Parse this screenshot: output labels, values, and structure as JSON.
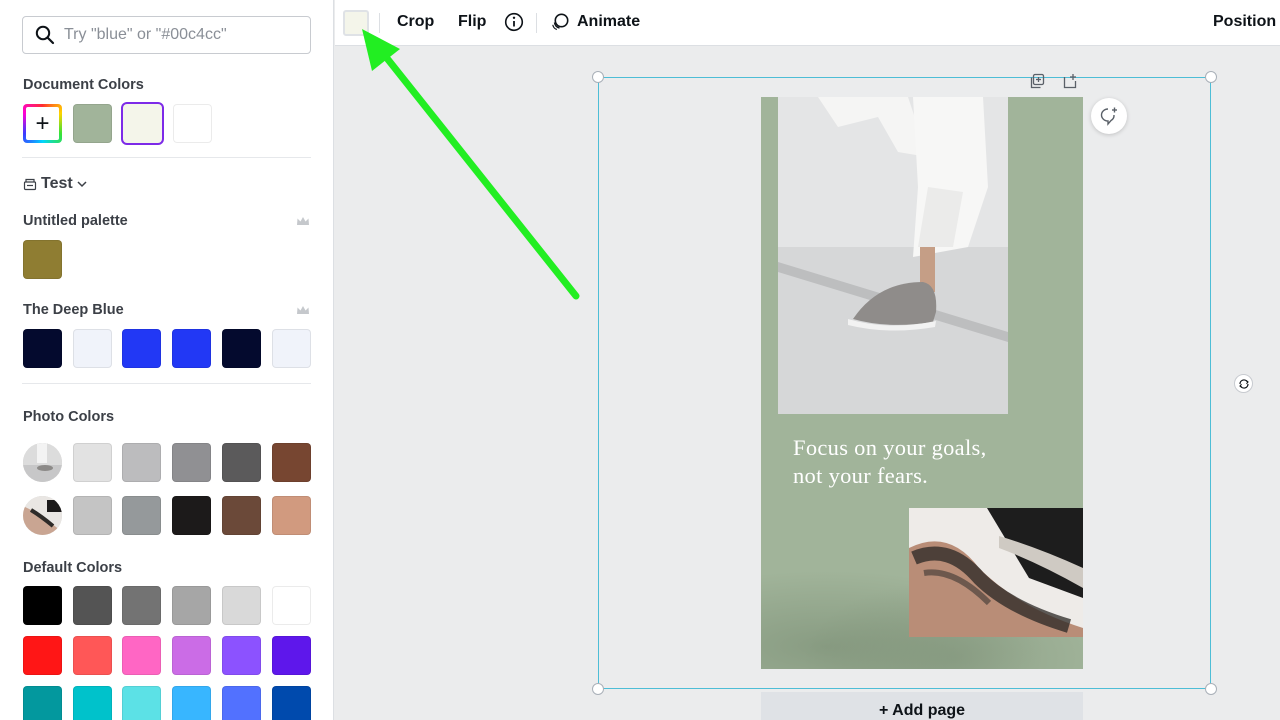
{
  "search": {
    "placeholder": "Try \"blue\" or \"#00c4cc\""
  },
  "document_colors": {
    "title": "Document Colors",
    "swatches": [
      "#a1b49a",
      "#f4f5ea",
      "#ffffff"
    ],
    "selected_index": 1
  },
  "brand_kit": {
    "label": "Test"
  },
  "palettes": [
    {
      "title": "Untitled palette",
      "swatches": [
        "#8f7d32"
      ]
    },
    {
      "title": "The Deep Blue",
      "swatches": [
        "#040a2e",
        "#f0f3fa",
        "#2238f5",
        "#2238f5",
        "#040a2e",
        "#f0f3fa"
      ]
    }
  ],
  "photo_colors": {
    "title": "Photo Colors",
    "rows": [
      [
        "#e2e2e2",
        "#bcbcbe",
        "#909093",
        "#5b5a5b",
        "#774631"
      ],
      [
        "#c4c4c4",
        "#95999b",
        "#1c1a1a",
        "#6b4939",
        "#d19a7f"
      ]
    ]
  },
  "default_colors": {
    "title": "Default Colors",
    "rows": [
      [
        "#000000",
        "#545454",
        "#737373",
        "#a6a6a6",
        "#d9d9d9",
        "#ffffff"
      ],
      [
        "#ff1616",
        "#ff5757",
        "#ff66c4",
        "#cb6ce6",
        "#8c52ff",
        "#5e17eb"
      ],
      [
        "#03989e",
        "#00c2cb",
        "#5ce1e6",
        "#38b6ff",
        "#5271ff",
        "#004aad"
      ]
    ]
  },
  "toolbar": {
    "color_value": "#f4f5ea",
    "crop": "Crop",
    "flip": "Flip",
    "animate": "Animate",
    "position": "Position"
  },
  "design": {
    "quote_line1": "Focus on your goals,",
    "quote_line2": "not your fears.",
    "background": "#a1b49a"
  },
  "add_page": "+ Add page",
  "accent": {
    "selection": "#7d2ae8",
    "frame": "#4dbdd6",
    "arrow": "#22ee22"
  }
}
